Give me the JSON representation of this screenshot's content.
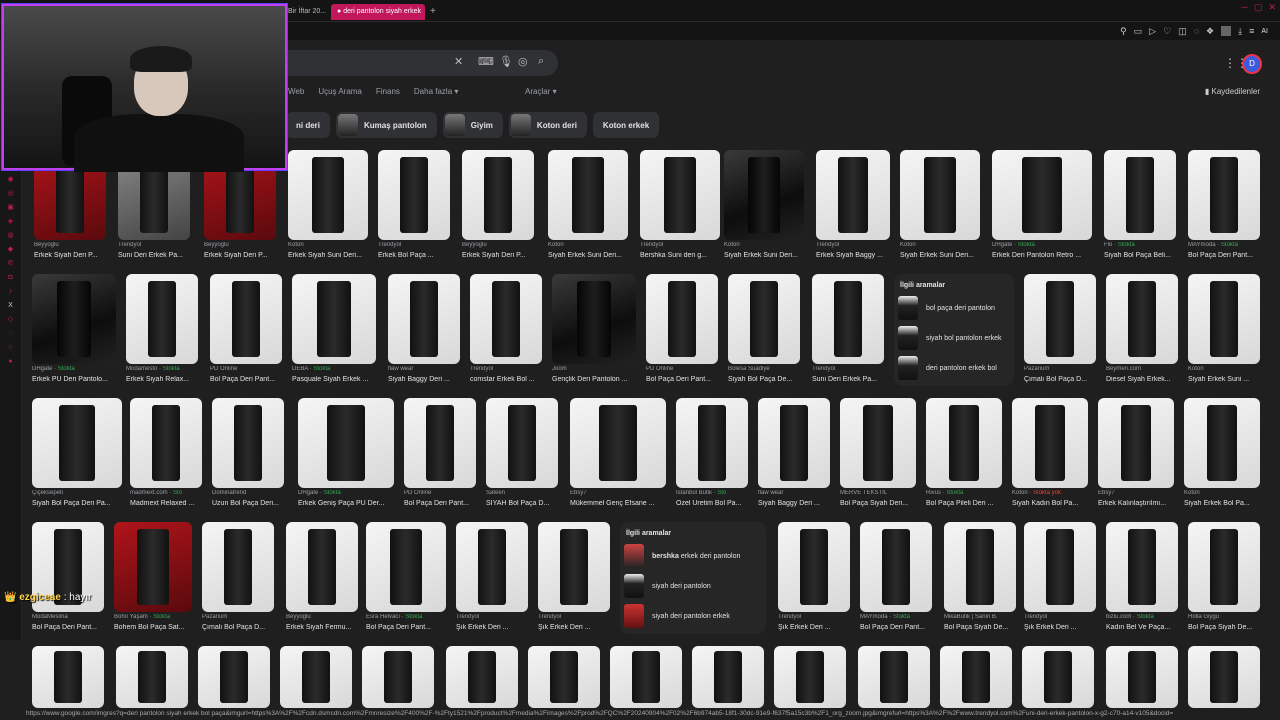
{
  "browser": {
    "tabs": [
      {
        "label": "Bir İftar 20..."
      },
      {
        "label": "deri pantolon siyah erkek"
      }
    ],
    "add_tab": "+",
    "toolbar_ai": "AI"
  },
  "search": {
    "value": ""
  },
  "avatar_letter": "D",
  "nav": {
    "tabs": [
      "Web",
      "Uçuş Arama",
      "Finans",
      "Daha fazla ▾"
    ],
    "tools": "Araçlar ▾",
    "saved": "Kaydedilenler"
  },
  "chips": [
    {
      "label": "ni deri",
      "thumb": false
    },
    {
      "label": "Kumaş pantolon",
      "thumb": true
    },
    {
      "label": "Giyim",
      "thumb": true
    },
    {
      "label": "Koton deri",
      "thumb": true
    },
    {
      "label": "Koton erkek",
      "thumb": false
    }
  ],
  "rows": [
    [
      {
        "src": "Beyyoglu",
        "title": "Erkek Siyah Deri P..."
      },
      {
        "src": "Trendyol",
        "title": "Suni Deri Erkek Pa..."
      },
      {
        "src": "Beyyoglu",
        "title": "Erkek Siyah Deri P..."
      },
      {
        "src": "Koton",
        "title": "Erkek Siyah Suni Deri..."
      },
      {
        "src": "Trendyol",
        "title": "Erkek Bol Paça ..."
      },
      {
        "src": "Beyyoglu",
        "title": "Erkek Siyah Deri P..."
      },
      {
        "src": "Koton",
        "title": "Siyah Erkek Suni Deri..."
      },
      {
        "src": "Trendyol",
        "title": "Bershka Suni deri g..."
      },
      {
        "src": "Koton",
        "title": "Siyah Erkek Suni Deri..."
      },
      {
        "src": "Trendyol",
        "title": "Erkek Siyah Baggy ..."
      },
      {
        "src": "Koton",
        "title": "Siyah Erkek Suni Deri..."
      },
      {
        "src": "DHgate",
        "stock": "Stokta",
        "title": "Erkek Deri Pantolon Retro ..."
      },
      {
        "src": "Flo",
        "stock": "Stokta",
        "title": "Siyah Bol Paça Beli..."
      },
      {
        "src": "MAYmoda",
        "stock": "Stokta",
        "title": "Bol Paça Deri Pant..."
      }
    ],
    [
      {
        "src": "DHgate",
        "stock": "Stokta",
        "title": "Erkek PU Deri Pantolo..."
      },
      {
        "src": "Modamesto",
        "stock": "Stokta",
        "title": "Erkek Siyah Relax..."
      },
      {
        "src": "PD Online",
        "title": "Bol Paça Deri Pant..."
      },
      {
        "src": "DEBA",
        "stock": "Stokta",
        "title": "Pasquale Siyah Erkek ..."
      },
      {
        "src": "flaw wear",
        "title": "Siyah Baggy Deri ..."
      },
      {
        "src": "Trendyol",
        "title": "comstar Erkek Bol ..."
      },
      {
        "src": "Joom",
        "title": "Gençlik Deri Pantolon ..."
      },
      {
        "src": "PD Online",
        "title": "Bol Paça Deri Pant..."
      },
      {
        "src": "Bolesa Suadiye",
        "title": "Siyah Bol Paça De..."
      },
      {
        "src": "Trendyol",
        "title": "Suni Deri Erkek Pa..."
      },
      {
        "src": "Pazarium",
        "title": "Çımalı Bol Paça D..."
      },
      {
        "src": "Beymen.com",
        "title": "Diesel Siyah Erkek..."
      },
      {
        "src": "Koton",
        "title": "Siyah Erkek Suni ..."
      }
    ],
    [
      {
        "src": "Çiçeksepeti",
        "title": "Siyah Bol Paça Deri Pa..."
      },
      {
        "src": "madmext.com",
        "stock": "Sto",
        "title": "Madmext Relaxed ..."
      },
      {
        "src": "Dominatrend",
        "title": "Uzun Bol Paça Deri..."
      },
      {
        "src": "DHgate",
        "stock": "Stokta",
        "title": "Erkek Geniş Paça PU Der..."
      },
      {
        "src": "PD Online",
        "title": "Bol Paça Deri Pant..."
      },
      {
        "src": "Sateen",
        "title": "SİYAH Bol Paça D..."
      },
      {
        "src": "Ebsy7",
        "title": "Mükemmel Genç Efsane ..."
      },
      {
        "src": "İstanbül Butik",
        "stock": "Sto",
        "title": "Özel Üretim Bol Pa..."
      },
      {
        "src": "flaw wear",
        "title": "Siyah Baggy Deri ..."
      },
      {
        "src": "MERVE TEKSTİL",
        "title": "Bol Paça Siyah Deri..."
      },
      {
        "src": "Rivus",
        "stock": "Stokta",
        "title": "Bol Paça Pileli Deri ..."
      },
      {
        "src": "Koton",
        "nostock": "Stokta yok",
        "title": "Siyah Kadın Bol Pa..."
      },
      {
        "src": "Ebsy7",
        "title": "Erkek Kalınlaştırılmı..."
      },
      {
        "src": "Koton",
        "title": "Siyah Erkek Bol Pa..."
      }
    ],
    [
      {
        "src": "ModaMeslina",
        "title": "Bol Paça Deri Pant..."
      },
      {
        "src": "Boho Yaşam",
        "stock": "Stokta",
        "title": "Bohem Bol Paça Sat..."
      },
      {
        "src": "Pazarium",
        "title": "Çımalı Bol Paça D..."
      },
      {
        "src": "Beyyoglu",
        "title": "Erkek Siyah Fermu..."
      },
      {
        "src": "Esra Helvacı",
        "stock": "Stokta",
        "title": "Bol Paça Deri Pant..."
      },
      {
        "src": "Trendyol",
        "title": "Şık Erkek Deri ..."
      },
      {
        "src": "Trendyol",
        "title": "Şık Erkek Deri ..."
      },
      {
        "src": "Trendyol",
        "title": "Şık Erkek Deri ..."
      },
      {
        "src": "MAYmoda",
        "stock": "Stokta",
        "title": "Bol Paça Deri Pant..."
      },
      {
        "src": "MikaButik | Sanin B.",
        "title": "Bol Paça Siyah De..."
      },
      {
        "src": "Trendyol",
        "title": "Şık Erkek Deri ..."
      },
      {
        "src": "bizlu.com",
        "stock": "Stokta",
        "title": "Kadın Bel Ve Paça..."
      },
      {
        "src": "Holla Giygu",
        "title": "Bol Paça Siyah De..."
      }
    ]
  ],
  "related1": {
    "heading": "İlgili aramalar",
    "items": [
      {
        "bold": "",
        "text": "bol paça deri pantolon"
      },
      {
        "bold": "",
        "text": "siyah bol pantolon erkek"
      },
      {
        "bold": "",
        "text": "deri pantolon erkek bol"
      }
    ]
  },
  "related2": {
    "heading": "İlgili aramalar",
    "items": [
      {
        "bold": "bershka",
        "text": "erkek deri pantolon"
      },
      {
        "bold": "",
        "text": "siyah deri pantolon"
      },
      {
        "bold": "",
        "text": "siyah deri pantolon erkek"
      }
    ]
  },
  "chat": {
    "user": "ezgiceae",
    "message": ": hayır"
  },
  "statusbar": "https://www.google.com/imgres?q=deri pantolon siyah erkek bol paça&imgurl=https%3A%2F%2Fcdn.dsmcdn.com%2Fmnresize%2F400%2F-%2Fty1521%2Fproduct%2Fmedia%2Fimages%2Fprod%2FQC%2F20240904%2F02%2F6b974ab5-18f1-30dc-91e9-f637f5a15c3b%2F1_org_zoom.jpg&imgrefurl=https%3A%2F%2Fwww.trendyol.com%2Funi-deri-erkek-pantolon-x-g2-c70-a14-v105&docid="
}
